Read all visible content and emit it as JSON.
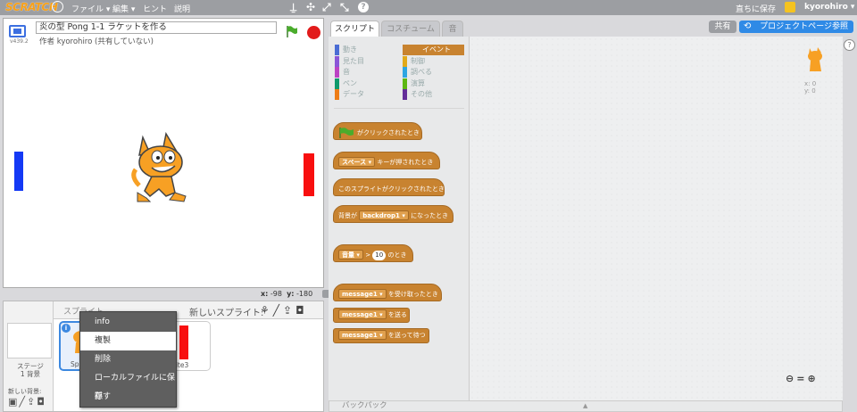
{
  "topbar": {
    "logo": "SCRATCH",
    "menus": [
      "ファイル ▾",
      "編集 ▾",
      "ヒント",
      "説明"
    ],
    "save": "直ちに保存",
    "username": "kyorohiro ▾"
  },
  "stage": {
    "version": "v439.2",
    "title": "炎の型 Pong 1-1 ラケットを作る",
    "author": "作者 kyorohiro (共有していない)",
    "x_label": "x:",
    "x_value": "-98",
    "y_label": "y:",
    "y_value": "-180",
    "colors": {
      "left_paddle": "#1439f5",
      "right_paddle": "#f80f0f"
    }
  },
  "sprites": {
    "title": "スプライト",
    "new_sprite": "新しいスプライト:",
    "stage_label": "ステージ",
    "stage_sub": "1 背景",
    "new_backdrop": "新しい背景:",
    "sprite1_label": "Sp",
    "sprite3_label": "prite3"
  },
  "context_menu": [
    "info",
    "複製",
    "削除",
    "ローカルファイルに保存",
    "隠す"
  ],
  "tabs": [
    "スクリプト",
    "コスチューム",
    "音"
  ],
  "header_buttons": {
    "share": "共有",
    "project_page": "プロジェクトページ参照"
  },
  "categories": [
    {
      "label": "動き",
      "color": "#4a6cd4"
    },
    {
      "label": "見た目",
      "color": "#8a55d7"
    },
    {
      "label": "音",
      "color": "#bb42c3"
    },
    {
      "label": "ペン",
      "color": "#0e9a6c"
    },
    {
      "label": "データ",
      "color": "#ee7d16"
    },
    {
      "label": "イベント",
      "color": "#c88330"
    },
    {
      "label": "制御",
      "color": "#e1a91a"
    },
    {
      "label": "調べる",
      "color": "#2ca5e2"
    },
    {
      "label": "演算",
      "color": "#5cb712"
    },
    {
      "label": "その他",
      "color": "#632d99"
    }
  ],
  "blocks": {
    "flag_clicked": "がクリックされたとき",
    "key_dropdown": "スペース ▾",
    "key_pressed": "キーが押されたとき",
    "sprite_clicked": "このスプライトがクリックされたとき",
    "backdrop_prefix": "背景が",
    "backdrop_dropdown": "backdrop1 ▾",
    "backdrop_suffix": "になったとき",
    "volume_dropdown": "音量 ▾",
    "gt": ">",
    "volume_value": "10",
    "volume_suffix": "のとき",
    "msg_dropdown": "message1 ▾",
    "receive": "を受け取ったとき",
    "broadcast": "を送る",
    "broadcast_wait": "を送って待つ"
  },
  "script_area": {
    "sprite_x": "x: 0",
    "sprite_y": "y: 0"
  },
  "backpack": "バックパック"
}
